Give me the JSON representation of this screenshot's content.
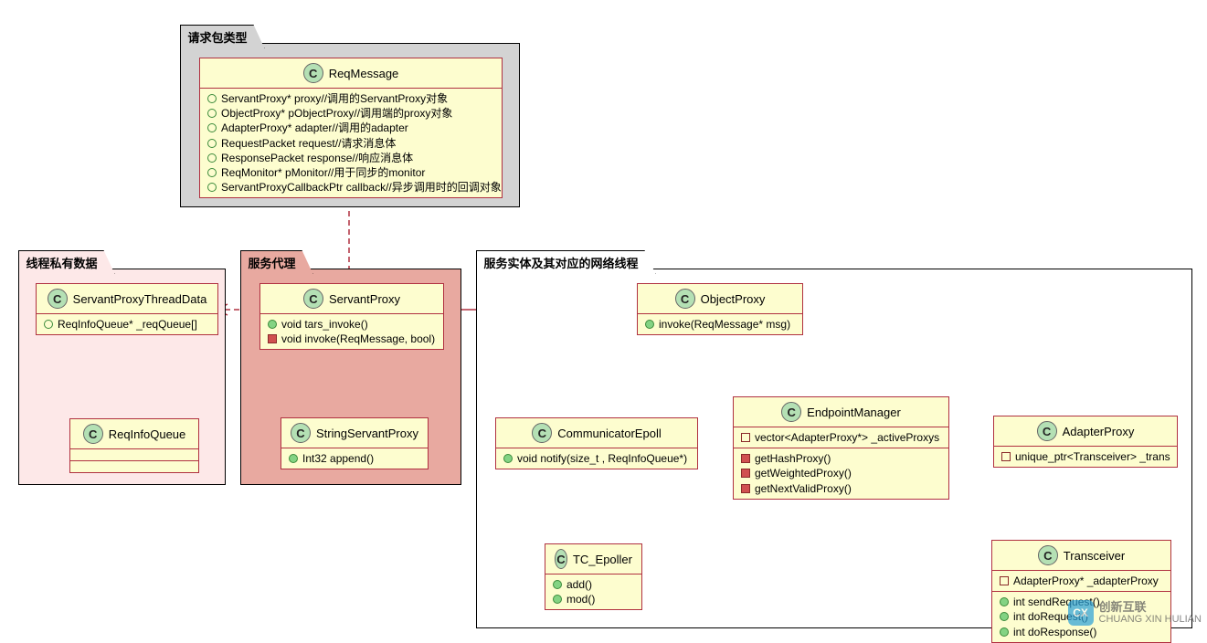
{
  "packages": {
    "req": {
      "title": "请求包类型"
    },
    "thread": {
      "title": "线程私有数据"
    },
    "proxy": {
      "title": "服务代理"
    },
    "entity": {
      "title": "服务实体及其对应的网络线程"
    }
  },
  "classes": {
    "ReqMessage": {
      "name": "ReqMessage",
      "fields": [
        "ServantProxy* proxy//调用的ServantProxy对象",
        "ObjectProxy*  pObjectProxy//调用端的proxy对象",
        "AdapterProxy* adapter//调用的adapter",
        "RequestPacket request//请求消息体",
        "ResponsePacket response//响应消息体",
        "ReqMonitor* pMonitor//用于同步的monitor",
        "ServantProxyCallbackPtr callback//异步调用时的回调对象"
      ]
    },
    "ServantProxyThreadData": {
      "name": "ServantProxyThreadData",
      "fields": [
        "ReqInfoQueue* _reqQueue[]"
      ]
    },
    "ReqInfoQueue": {
      "name": "ReqInfoQueue"
    },
    "ServantProxy": {
      "name": "ServantProxy",
      "methods": [
        {
          "vis": "public",
          "text": "void tars_invoke()"
        },
        {
          "vis": "private",
          "text": "void invoke(ReqMessage, bool)"
        }
      ]
    },
    "StringServantProxy": {
      "name": "StringServantProxy",
      "methods": [
        {
          "vis": "public",
          "text": "Int32 append()"
        }
      ]
    },
    "ObjectProxy": {
      "name": "ObjectProxy",
      "methods": [
        {
          "vis": "public",
          "text": "invoke(ReqMessage* msg)"
        }
      ]
    },
    "CommunicatorEpoll": {
      "name": "CommunicatorEpoll",
      "methods": [
        {
          "vis": "public",
          "text": "void notify(size_t , ReqInfoQueue*)"
        }
      ]
    },
    "TC_Epoller": {
      "name": "TC_Epoller",
      "methods": [
        {
          "vis": "public",
          "text": "add()"
        },
        {
          "vis": "public",
          "text": "mod()"
        }
      ]
    },
    "EndpointManager": {
      "name": "EndpointManager",
      "fields": [
        "vector<AdapterProxy*> _activeProxys"
      ],
      "methods": [
        {
          "vis": "private",
          "text": "getHashProxy()"
        },
        {
          "vis": "private",
          "text": "getWeightedProxy()"
        },
        {
          "vis": "private",
          "text": "getNextValidProxy()"
        }
      ]
    },
    "AdapterProxy": {
      "name": "AdapterProxy",
      "fields": [
        "unique_ptr<Transceiver> _trans"
      ]
    },
    "Transceiver": {
      "name": "Transceiver",
      "fields": [
        "AdapterProxy* _adapterProxy"
      ],
      "methods": [
        {
          "vis": "public",
          "text": "int sendRequest()"
        },
        {
          "vis": "public",
          "text": "int doRequest()"
        },
        {
          "vis": "public",
          "text": "int doResponse()"
        }
      ]
    }
  },
  "watermark": {
    "top": "创新互联",
    "bottom": "CHUANG XIN HULIAN"
  },
  "chart_data": {
    "type": "uml-class-diagram",
    "packages": [
      {
        "name": "请求包类型",
        "classes": [
          "ReqMessage"
        ]
      },
      {
        "name": "线程私有数据",
        "classes": [
          "ServantProxyThreadData",
          "ReqInfoQueue"
        ]
      },
      {
        "name": "服务代理",
        "classes": [
          "ServantProxy",
          "StringServantProxy"
        ]
      },
      {
        "name": "服务实体及其对应的网络线程",
        "classes": [
          "ObjectProxy",
          "CommunicatorEpoll",
          "TC_Epoller",
          "EndpointManager",
          "AdapterProxy",
          "Transceiver"
        ]
      }
    ],
    "relationships": [
      {
        "from": "ServantProxy",
        "to": "ReqMessage",
        "type": "dependency"
      },
      {
        "from": "ServantProxy",
        "to": "ServantProxyThreadData",
        "type": "dependency"
      },
      {
        "from": "ServantProxyThreadData",
        "to": "ReqInfoQueue",
        "type": "association"
      },
      {
        "from": "StringServantProxy",
        "to": "ServantProxy",
        "type": "generalization"
      },
      {
        "from": "ServantProxy",
        "to": "ObjectProxy",
        "type": "aggregation"
      },
      {
        "from": "ObjectProxy",
        "to": "CommunicatorEpoll",
        "type": "association"
      },
      {
        "from": "ObjectProxy",
        "to": "EndpointManager",
        "type": "association"
      },
      {
        "from": "ObjectProxy",
        "to": "AdapterProxy",
        "type": "dependency"
      },
      {
        "from": "EndpointManager",
        "to": "AdapterProxy",
        "type": "dependency"
      },
      {
        "from": "CommunicatorEpoll",
        "to": "TC_Epoller",
        "type": "association"
      },
      {
        "from": "AdapterProxy",
        "to": "Transceiver",
        "type": "aggregation"
      }
    ]
  }
}
